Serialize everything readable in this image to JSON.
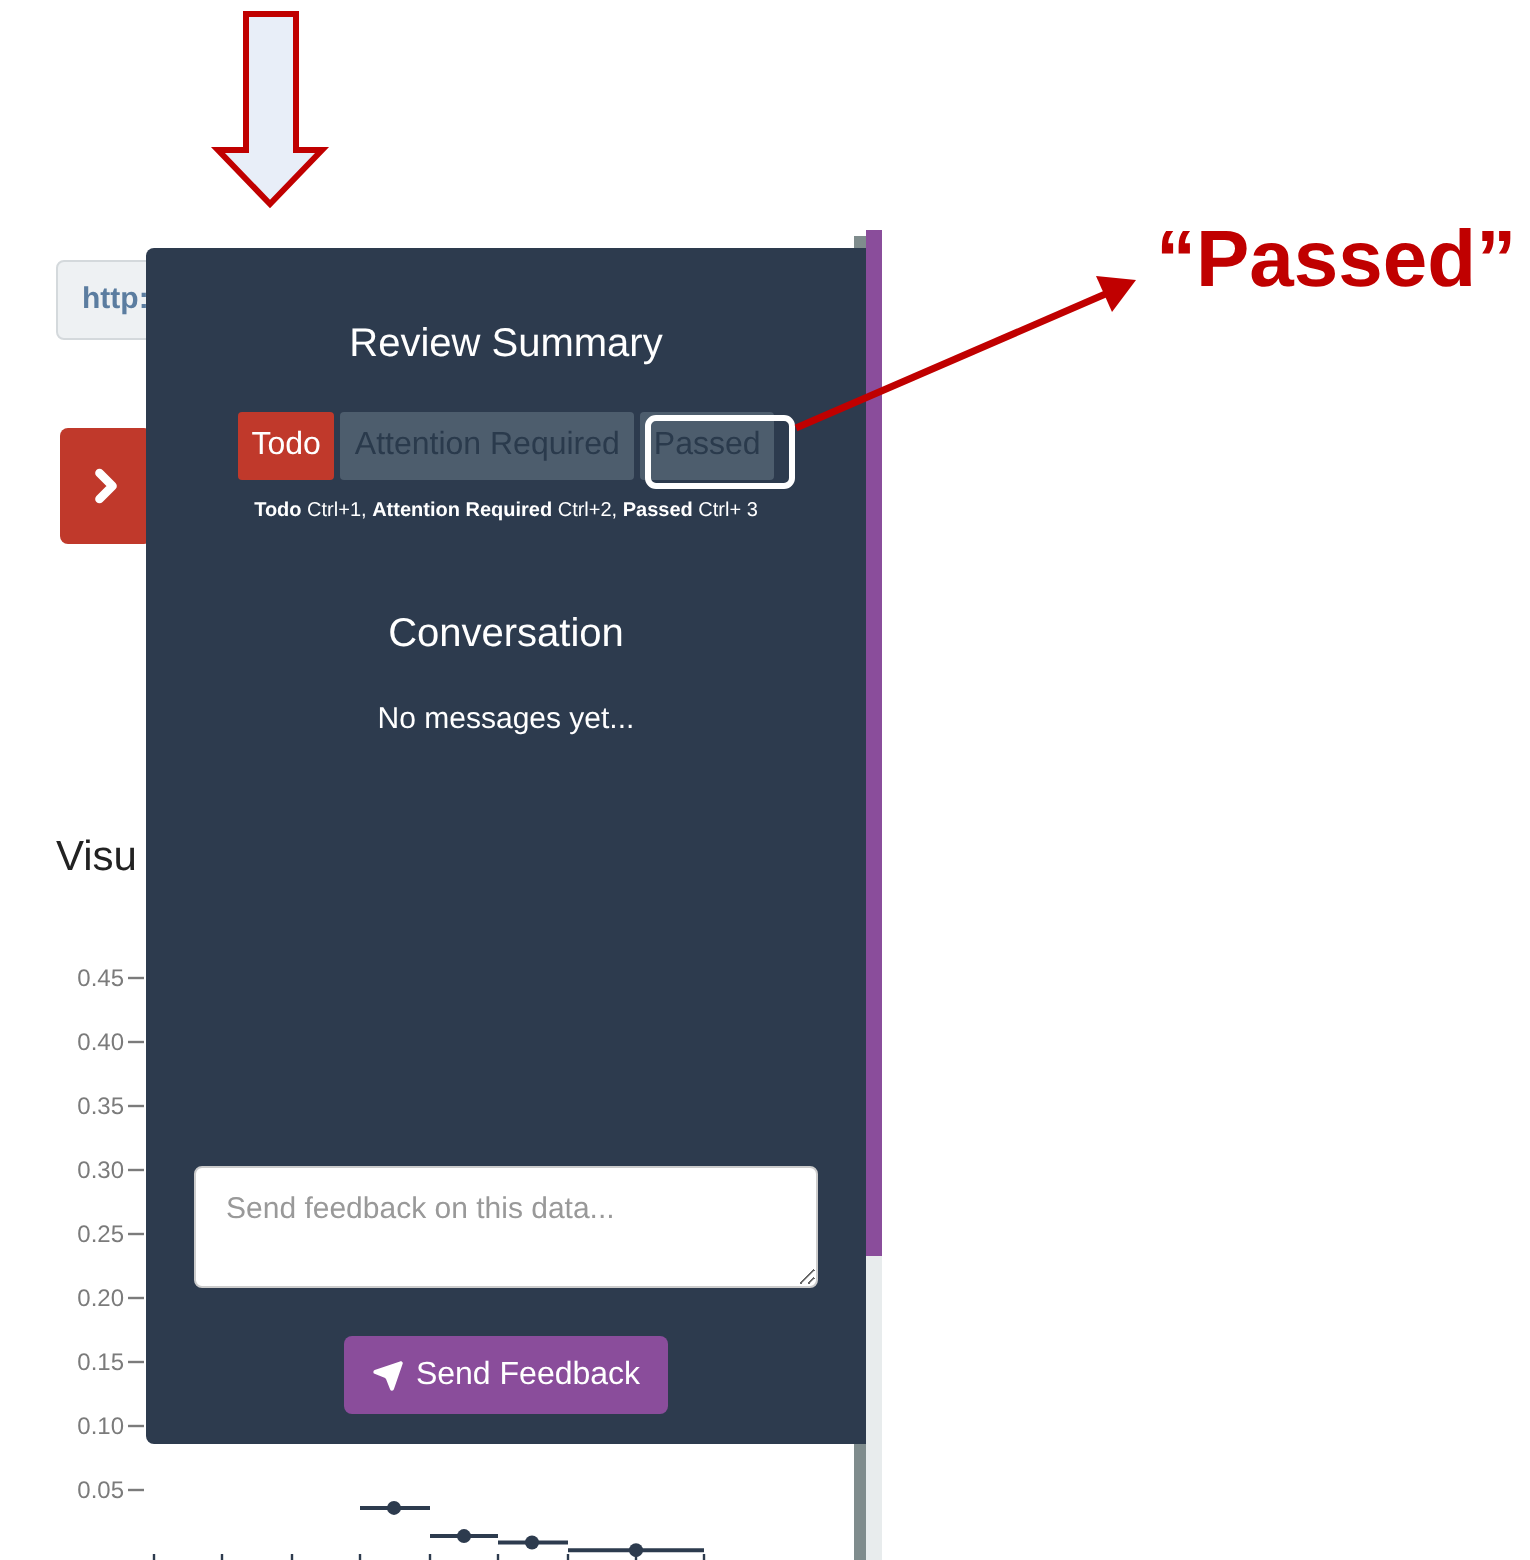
{
  "page": {
    "url_field": "http:",
    "heading": "Visu",
    "chart": {
      "y_tick_labels": [
        "0.45",
        "0.40",
        "0.35",
        "0.30",
        "0.25",
        "0.20",
        "0.15",
        "0.10",
        "0.05"
      ]
    }
  },
  "review_panel": {
    "title": "Review Summary",
    "tabs": [
      {
        "label": "Todo",
        "selected": true
      },
      {
        "label": "Attention Required",
        "selected": false
      },
      {
        "label": "Passed",
        "selected": false
      }
    ],
    "shortcut_hint": "**Todo** Ctrl+1, **Attention Required** Ctrl+2, **Passed** Ctrl+ 3",
    "conversation_title": "Conversation",
    "empty_message": "No messages yet...",
    "feedback": {
      "placeholder": "Send feedback on this data..."
    },
    "send_button": "Send Feedback"
  },
  "annotation": {
    "callout": "“Passed”"
  }
}
